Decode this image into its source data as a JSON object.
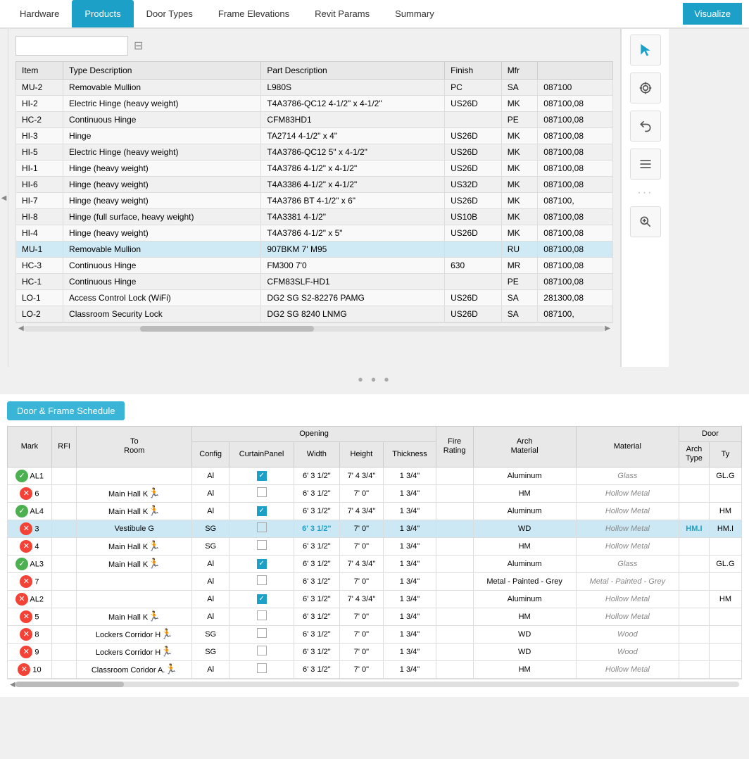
{
  "tabs": [
    {
      "label": "Hardware",
      "active": false
    },
    {
      "label": "Products",
      "active": true
    },
    {
      "label": "Door Types",
      "active": false
    },
    {
      "label": "Frame Elevations",
      "active": false
    },
    {
      "label": "Revit Params",
      "active": false
    },
    {
      "label": "Summary",
      "active": false
    }
  ],
  "visualize_btn": "Visualize",
  "search_placeholder": "",
  "right_icons": [
    "cursor-icon",
    "target-icon",
    "back-icon",
    "list-icon",
    "search-zoom-icon"
  ],
  "products_columns": [
    "Item",
    "Type Description",
    "Part Description",
    "Finish",
    "Mfr"
  ],
  "products_rows": [
    {
      "item": "MU-2",
      "type_desc": "Removable Mullion",
      "part_desc": "L980S",
      "finish": "PC",
      "mfr": "SA",
      "extra": "087100"
    },
    {
      "item": "HI-2",
      "type_desc": "Electric Hinge (heavy weight)",
      "part_desc": "T4A3786-QC12 4-1/2\" x 4-1/2\"",
      "finish": "US26D",
      "mfr": "MK",
      "extra": "087100,08"
    },
    {
      "item": "HC-2",
      "type_desc": "Continuous Hinge",
      "part_desc": "CFM83HD1",
      "finish": "",
      "mfr": "PE",
      "extra": "087100,08"
    },
    {
      "item": "HI-3",
      "type_desc": "Hinge",
      "part_desc": "TA2714 4-1/2\" x 4\"",
      "finish": "US26D",
      "mfr": "MK",
      "extra": "087100,08"
    },
    {
      "item": "HI-5",
      "type_desc": "Electric Hinge (heavy weight)",
      "part_desc": "T4A3786-QC12 5\" x 4-1/2\"",
      "finish": "US26D",
      "mfr": "MK",
      "extra": "087100,08"
    },
    {
      "item": "HI-1",
      "type_desc": "Hinge (heavy weight)",
      "part_desc": "T4A3786 4-1/2\" x 4-1/2\"",
      "finish": "US26D",
      "mfr": "MK",
      "extra": "087100,08"
    },
    {
      "item": "HI-6",
      "type_desc": "Hinge (heavy weight)",
      "part_desc": "T4A3386 4-1/2\" x 4-1/2\"",
      "finish": "US32D",
      "mfr": "MK",
      "extra": "087100,08"
    },
    {
      "item": "HI-7",
      "type_desc": "Hinge (heavy weight)",
      "part_desc": "T4A3786 BT 4-1/2\" x 6\"",
      "finish": "US26D",
      "mfr": "MK",
      "extra": "087100,"
    },
    {
      "item": "HI-8",
      "type_desc": "Hinge (full surface, heavy weight)",
      "part_desc": "T4A3381 4-1/2\"",
      "finish": "US10B",
      "mfr": "MK",
      "extra": "087100,08"
    },
    {
      "item": "HI-4",
      "type_desc": "Hinge (heavy weight)",
      "part_desc": "T4A3786 4-1/2\" x 5\"",
      "finish": "US26D",
      "mfr": "MK",
      "extra": "087100,08"
    },
    {
      "item": "MU-1",
      "type_desc": "Removable Mullion",
      "part_desc": "907BKM 7' M95",
      "finish": "",
      "mfr": "RU",
      "extra": "087100,08",
      "selected": true
    },
    {
      "item": "HC-3",
      "type_desc": "Continuous Hinge",
      "part_desc": "FM300 7'0",
      "finish": "630",
      "mfr": "MR",
      "extra": "087100,08"
    },
    {
      "item": "HC-1",
      "type_desc": "Continuous Hinge",
      "part_desc": "CFM83SLF-HD1",
      "finish": "",
      "mfr": "PE",
      "extra": "087100,08"
    },
    {
      "item": "LO-1",
      "type_desc": "Access Control Lock (WiFi)",
      "part_desc": "DG2 SG S2-82276 PAMG",
      "finish": "US26D",
      "mfr": "SA",
      "extra": "281300,08"
    },
    {
      "item": "LO-2",
      "type_desc": "Classroom Security Lock",
      "part_desc": "DG2 SG 8240 LNMG",
      "finish": "US26D",
      "mfr": "SA",
      "extra": "087100,"
    }
  ],
  "schedule_title": "Door & Frame Schedule",
  "schedule_col_groups": {
    "opening": "Opening",
    "door_arch_type": "Door"
  },
  "schedule_columns": [
    "Mark",
    "RFI",
    "To Room",
    "Config",
    "CurtainPanel",
    "Width",
    "Height",
    "Thickness",
    "Fire Rating",
    "Arch Material",
    "Material",
    "Door Arch Type",
    "Ty"
  ],
  "schedule_rows": [
    {
      "mark": "AL1",
      "rfi": "",
      "to_room": "",
      "config": "Al",
      "curtain": true,
      "width": "6' 3 1/2\"",
      "height": "7' 4 3/4\"",
      "thickness": "1 3/4\"",
      "fire": "",
      "arch_mat": "Aluminum",
      "material": "Glass",
      "door_arch_type": "",
      "ty": "GL.G",
      "status": "green",
      "has_run": false,
      "selected": false
    },
    {
      "mark": "6",
      "rfi": "",
      "to_room": "Main Hall K",
      "config": "Al",
      "curtain": false,
      "width": "6' 3 1/2\"",
      "height": "7' 0\"",
      "thickness": "1 3/4\"",
      "fire": "",
      "arch_mat": "HM",
      "material": "Hollow Metal",
      "door_arch_type": "",
      "ty": "",
      "status": "red",
      "has_run": true,
      "selected": false
    },
    {
      "mark": "AL4",
      "rfi": "",
      "to_room": "Main Hall K",
      "config": "Al",
      "curtain": true,
      "width": "6' 3 1/2\"",
      "height": "7' 4 3/4\"",
      "thickness": "1 3/4\"",
      "fire": "",
      "arch_mat": "Aluminum",
      "material": "Hollow Metal",
      "door_arch_type": "",
      "ty": "HM",
      "status": "green",
      "has_run": true,
      "selected": false
    },
    {
      "mark": "3",
      "rfi": "",
      "to_room": "Vestibule G",
      "config": "SG",
      "curtain": false,
      "width": "6' 3 1/2\"",
      "height": "7' 0\"",
      "thickness": "1 3/4\"",
      "fire": "",
      "arch_mat": "WD",
      "material": "Hollow Metal",
      "door_arch_type": "HM.I",
      "ty": "HM.I",
      "status": "red",
      "has_run": false,
      "selected": true
    },
    {
      "mark": "4",
      "rfi": "",
      "to_room": "Main Hall K",
      "config": "SG",
      "curtain": false,
      "width": "6' 3 1/2\"",
      "height": "7' 0\"",
      "thickness": "1 3/4\"",
      "fire": "",
      "arch_mat": "HM",
      "material": "Hollow Metal",
      "door_arch_type": "",
      "ty": "",
      "status": "red",
      "has_run": true,
      "selected": false
    },
    {
      "mark": "AL3",
      "rfi": "",
      "to_room": "Main Hall K",
      "config": "Al",
      "curtain": true,
      "width": "6' 3 1/2\"",
      "height": "7' 4 3/4\"",
      "thickness": "1 3/4\"",
      "fire": "",
      "arch_mat": "Aluminum",
      "material": "Glass",
      "door_arch_type": "",
      "ty": "GL.G",
      "status": "green",
      "has_run": true,
      "selected": false
    },
    {
      "mark": "7",
      "rfi": "",
      "to_room": "",
      "config": "Al",
      "curtain": false,
      "width": "6' 3 1/2\"",
      "height": "7' 0\"",
      "thickness": "1 3/4\"",
      "fire": "",
      "arch_mat": "Metal - Painted - Grey",
      "material": "Metal - Painted - Grey",
      "door_arch_type": "",
      "ty": "",
      "status": "red",
      "has_run": false,
      "selected": false
    },
    {
      "mark": "AL2",
      "rfi": "",
      "to_room": "",
      "config": "Al",
      "curtain": true,
      "width": "6' 3 1/2\"",
      "height": "7' 4 3/4\"",
      "thickness": "1 3/4\"",
      "fire": "",
      "arch_mat": "Aluminum",
      "material": "Hollow Metal",
      "door_arch_type": "",
      "ty": "HM",
      "status": "red",
      "has_run": false,
      "selected": false
    },
    {
      "mark": "5",
      "rfi": "",
      "to_room": "Main Hall K",
      "config": "Al",
      "curtain": false,
      "width": "6' 3 1/2\"",
      "height": "7' 0\"",
      "thickness": "1 3/4\"",
      "fire": "",
      "arch_mat": "HM",
      "material": "Hollow Metal",
      "door_arch_type": "",
      "ty": "",
      "status": "red",
      "has_run": true,
      "selected": false
    },
    {
      "mark": "8",
      "rfi": "",
      "to_room": "Lockers Corridor H",
      "config": "SG",
      "curtain": false,
      "width": "6' 3 1/2\"",
      "height": "7' 0\"",
      "thickness": "1 3/4\"",
      "fire": "",
      "arch_mat": "WD",
      "material": "Wood",
      "door_arch_type": "",
      "ty": "",
      "status": "red",
      "has_run": true,
      "selected": false
    },
    {
      "mark": "9",
      "rfi": "",
      "to_room": "Lockers Corridor H",
      "config": "SG",
      "curtain": false,
      "width": "6' 3 1/2\"",
      "height": "7' 0\"",
      "thickness": "1 3/4\"",
      "fire": "",
      "arch_mat": "WD",
      "material": "Wood",
      "door_arch_type": "",
      "ty": "",
      "status": "red",
      "has_run": true,
      "selected": false
    },
    {
      "mark": "10",
      "rfi": "",
      "to_room": "Classroom Coridor A.",
      "config": "Al",
      "curtain": false,
      "width": "6' 3 1/2\"",
      "height": "7' 0\"",
      "thickness": "1 3/4\"",
      "fire": "",
      "arch_mat": "HM",
      "material": "Hollow Metal",
      "door_arch_type": "",
      "ty": "",
      "status": "red",
      "has_run": true,
      "selected": false
    }
  ]
}
